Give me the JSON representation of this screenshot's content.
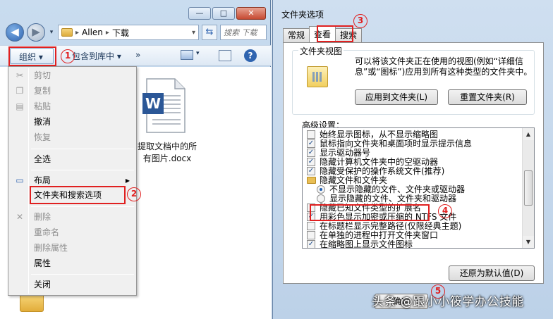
{
  "explorer": {
    "window_buttons": {
      "minimize": "—",
      "maximize": "□",
      "close": "✕"
    },
    "breadcrumb": [
      "Allen",
      "下载"
    ],
    "breadcrumb_separator": "▸",
    "search_placeholder": "搜索 下载",
    "toolbar": {
      "organize": "组织 ▾",
      "include_in_library": "包含到库中 ▾",
      "more": "»"
    },
    "file": {
      "name": "提取文档中的所有图片.docx",
      "line1": "提取文档中的所",
      "line2": "有图片.docx",
      "badge": "W"
    },
    "context_menu": {
      "items": [
        {
          "label": "剪切",
          "disabled": true
        },
        {
          "label": "复制",
          "disabled": true
        },
        {
          "label": "粘贴",
          "disabled": true
        },
        {
          "label": "撤消",
          "disabled": false
        },
        {
          "label": "恢复",
          "disabled": true
        },
        {
          "label": "全选",
          "disabled": false
        },
        {
          "label": "布局",
          "disabled": false
        },
        {
          "label": "文件夹和搜索选项",
          "disabled": false
        },
        {
          "label": "删除",
          "disabled": true
        },
        {
          "label": "重命名",
          "disabled": true
        },
        {
          "label": "删除属性",
          "disabled": true
        },
        {
          "label": "属性",
          "disabled": false
        },
        {
          "label": "关闭",
          "disabled": false
        }
      ]
    }
  },
  "dialog": {
    "title": "文件夹选项",
    "tabs": [
      "常规",
      "查看",
      "搜索"
    ],
    "active_tab": "查看",
    "folder_views": {
      "group_title": "文件夹视图",
      "description": "可以将该文件夹正在使用的视图(例如“详细信息”或“图标”)应用到所有这种类型的文件夹中。",
      "apply_button": "应用到文件夹(L)",
      "reset_button": "重置文件夹(R)"
    },
    "advanced": {
      "label": "高级设置：",
      "rows": [
        {
          "kind": "check",
          "checked": false,
          "indent": 0,
          "text": "始终显示图标，从不显示缩略图"
        },
        {
          "kind": "check",
          "checked": true,
          "indent": 0,
          "text": "鼠标指向文件夹和桌面项时显示提示信息"
        },
        {
          "kind": "check",
          "checked": true,
          "indent": 0,
          "text": "显示驱动器号"
        },
        {
          "kind": "check",
          "checked": true,
          "indent": 0,
          "text": "隐藏计算机文件夹中的空驱动器"
        },
        {
          "kind": "check",
          "checked": true,
          "indent": 0,
          "text": "隐藏受保护的操作系统文件(推荐)"
        },
        {
          "kind": "folder",
          "checked": false,
          "indent": 0,
          "text": "隐藏文件和文件夹"
        },
        {
          "kind": "radio",
          "checked": true,
          "indent": 1,
          "text": "不显示隐藏的文件、文件夹或驱动器"
        },
        {
          "kind": "radio",
          "checked": false,
          "indent": 1,
          "text": "显示隐藏的文件、文件夹和驱动器"
        },
        {
          "kind": "check",
          "checked": false,
          "indent": 0,
          "text": "隐藏已知文件类型的扩展名"
        },
        {
          "kind": "check",
          "checked": true,
          "indent": 0,
          "text": "用彩色显示加密或压缩的 NTFS 文件"
        },
        {
          "kind": "check",
          "checked": false,
          "indent": 0,
          "text": "在标题栏显示完整路径(仅限经典主题)"
        },
        {
          "kind": "check",
          "checked": false,
          "indent": 0,
          "text": "在单独的进程中打开文件夹窗口"
        },
        {
          "kind": "check",
          "checked": true,
          "indent": 0,
          "text": "在缩略图上显示文件图标"
        }
      ]
    },
    "restore_button": "还原为默认值(D)",
    "ok_button": "确定"
  },
  "annotations": {
    "step1": "1",
    "step2": "2",
    "step3": "3",
    "step4": "4",
    "step5": "5"
  },
  "watermark": "头条 @跟小小筱学办公技能",
  "colors": {
    "annotation_red": "#e02020",
    "word_blue": "#2b5797"
  }
}
